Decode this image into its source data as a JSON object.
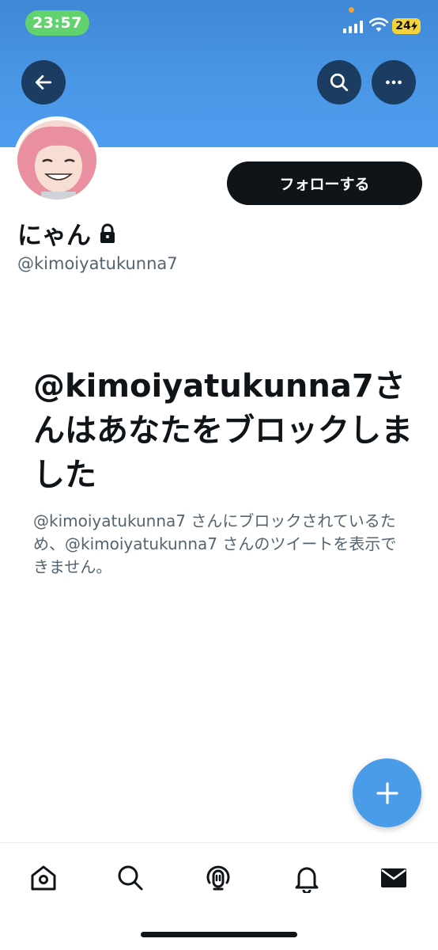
{
  "status_bar": {
    "time": "23:57",
    "battery": "24"
  },
  "header": {
    "back_icon": "arrow-left-icon",
    "search_icon": "search-icon",
    "more_icon": "more-horizontal-icon"
  },
  "profile": {
    "follow_label": "フォローする",
    "display_name": "にゃん",
    "handle": "@kimoiyatukunna7",
    "protected_icon": "lock-icon"
  },
  "blocked_message": {
    "title": "@kimoiyatukunna7さんはあなたをブロックしました",
    "description": "@kimoiyatukunna7 さんにブロックされているため、@kimoiyatukunna7 さんのツイートを表示できません。"
  },
  "nav": {
    "items": [
      "home-icon",
      "search-icon",
      "spaces-icon",
      "notifications-icon",
      "messages-icon"
    ]
  },
  "colors": {
    "banner": "#4a97e6",
    "fab": "#4a9be8",
    "follow_button": "#0f1419",
    "secondary_text": "#536471"
  }
}
